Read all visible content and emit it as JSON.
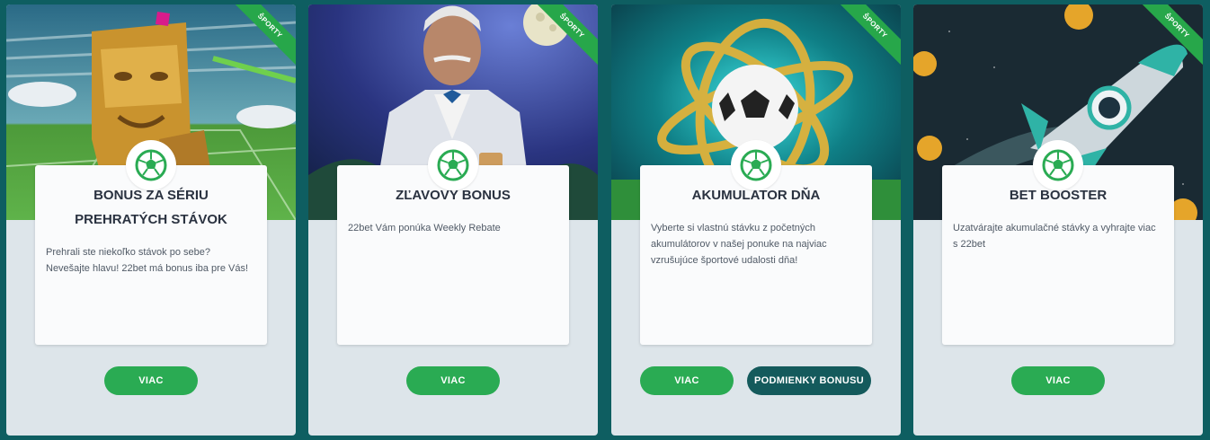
{
  "badge_label": "ŠPORTY",
  "colors": {
    "background": "#0e5e61",
    "card": "#dde5ea",
    "primary_button": "#2aab53",
    "secondary_button": "#145a5c",
    "ribbon": "#27a74a"
  },
  "cards": [
    {
      "title": "BONUS ZA SÉRIU PREHRATÝCH STÁVOK",
      "description": "Prehrali ste niekoľko stávok po sebe? Nevešajte hlavu! 22bet má bonus iba pre Vás!",
      "image": "tiki-totem-stadium",
      "buttons": [
        {
          "label": "VIAC"
        }
      ]
    },
    {
      "title": "ZĽAVOVY BONUS",
      "description": "22bet Vám ponúka Weekly Rebate",
      "image": "gentleman-night",
      "buttons": [
        {
          "label": "VIAC"
        }
      ]
    },
    {
      "title": "AKUMULATOR DŇA",
      "description": "Vyberte si vlastnú stávku z početných akumulátorov v našej ponuke na najviac vzrušujúce športové udalosti dňa!",
      "image": "ball-golden-rings",
      "buttons": [
        {
          "label": "VIAC"
        },
        {
          "label": "PODMIENKY BONUSU"
        }
      ]
    },
    {
      "title": "BET BOOSTER",
      "description": "Uzatvárajte akumulačné stávky a vyhrajte viac s 22bet",
      "image": "rocket-coins",
      "buttons": [
        {
          "label": "VIAC"
        }
      ]
    }
  ]
}
